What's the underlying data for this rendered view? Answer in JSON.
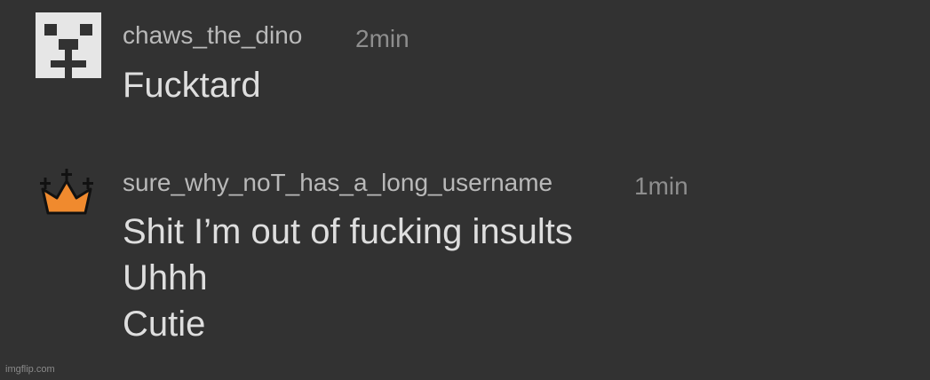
{
  "comments": [
    {
      "avatar_icon": "pixel-creeper-face-icon",
      "avatar_color": "#e6e6e6",
      "username": "chaws_the_dino",
      "timestamp": "2min",
      "lines": [
        "Fucktard"
      ]
    },
    {
      "avatar_icon": "crown-icon",
      "avatar_color": "#f08a2e",
      "username": "sure_why_noT_has_a_long_username",
      "timestamp": "1min",
      "lines": [
        "Shit I’m out of fucking insults",
        "Uhhh",
        "Cutie"
      ]
    }
  ],
  "watermark": "imgflip.com",
  "colors": {
    "background": "#323232",
    "username": "#b9b9b9",
    "timestamp": "#8e8e8e",
    "body_text": "#dedede"
  }
}
